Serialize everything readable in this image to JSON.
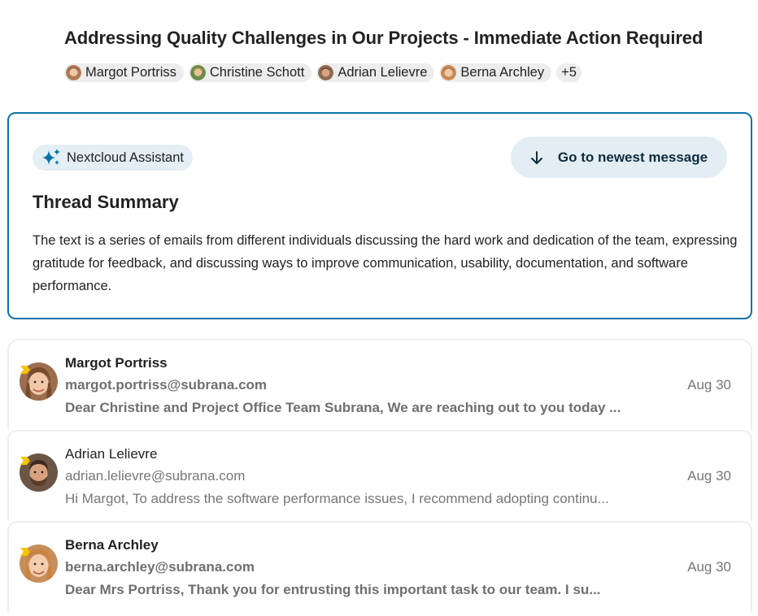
{
  "thread": {
    "title": "Addressing Quality Challenges in Our Projects - Immediate Action Required",
    "participants": [
      {
        "name": "Margot Portriss"
      },
      {
        "name": "Christine Schott"
      },
      {
        "name": "Adrian Lelievre"
      },
      {
        "name": "Berna Archley"
      }
    ],
    "more_count": "+5"
  },
  "summary": {
    "assistant_label": "Nextcloud Assistant",
    "newest_button": "Go to newest message",
    "title": "Thread Summary",
    "text": "The text is a series of emails from different individuals discussing the hard work and dedication of the team, expressing gratitude for feedback, and discussing ways to improve communication, usability, documentation, and software performance."
  },
  "messages": [
    {
      "sender": "Margot Portriss",
      "email": "margot.portriss@subrana.com",
      "preview": "Dear Christine and Project Office Team Subrana, We are reaching out to you today ...",
      "date": "Aug 30",
      "unread": true
    },
    {
      "sender": "Adrian Lelievre",
      "email": "adrian.lelievre@subrana.com",
      "preview": "Hi Margot,   To address the software performance issues, I recommend adopting continu...",
      "date": "Aug 30",
      "unread": false
    },
    {
      "sender": "Berna Archley",
      "email": "berna.archley@subrana.com",
      "preview": "Dear Mrs Portriss,   Thank you for entrusting this important task to our team.   I su...",
      "date": "Aug 30",
      "unread": true
    }
  ],
  "colors": {
    "accent": "#0b72a8",
    "important_marker": "#f5c400"
  }
}
